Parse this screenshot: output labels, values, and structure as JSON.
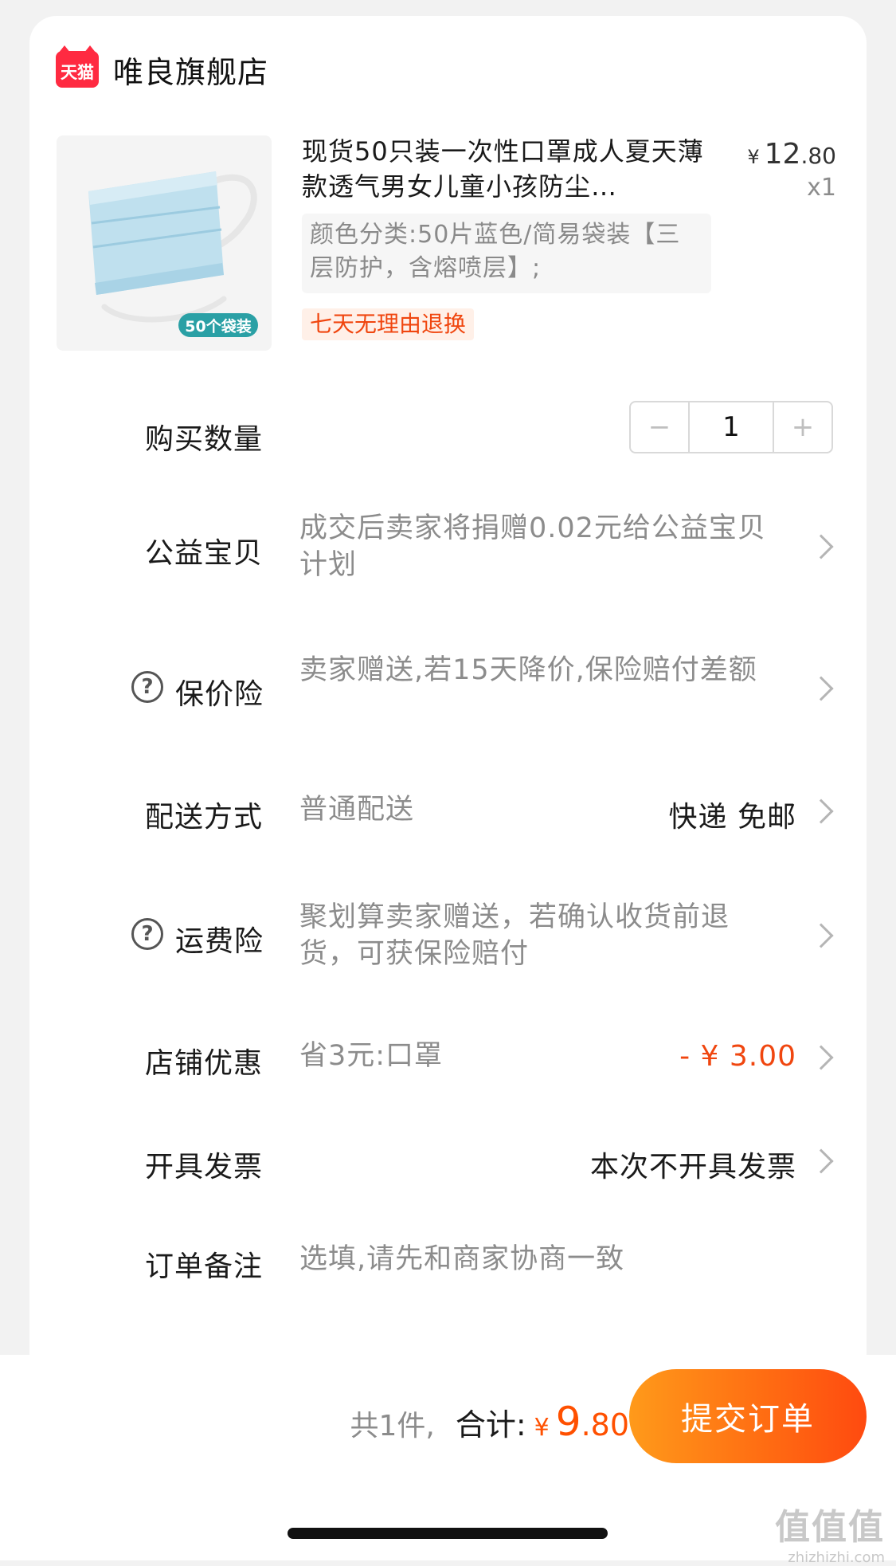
{
  "store": {
    "logo_text": "天猫",
    "name": "唯良旗舰店"
  },
  "product": {
    "badge": "50个袋装",
    "title": "现货50只装一次性口罩成人夏天薄款透气男女儿童小孩防尘…",
    "price_symbol": "¥",
    "price_int": "12",
    "price_dec": ".80",
    "quantity_text": "x1",
    "sku": "颜色分类:50片蓝色/简易袋装【三层防护，含熔喷层】;",
    "tag": "七天无理由退换"
  },
  "rows": {
    "quantity": {
      "label": "购买数量",
      "minus": "−",
      "value": "1",
      "plus": "+"
    },
    "charity": {
      "label": "公益宝贝",
      "value": "成交后卖家将捐赠0.02元给公益宝贝计划"
    },
    "price_protect": {
      "label": "保价险",
      "value": "卖家赠送,若15天降价,保险赔付差额"
    },
    "delivery": {
      "label": "配送方式",
      "value": "普通配送",
      "right": "快递 免邮"
    },
    "shipping_ins": {
      "label": "运费险",
      "value": "聚划算卖家赠送，若确认收货前退货，可获保险赔付"
    },
    "discount": {
      "label": "店铺优惠",
      "value": "省3元:口罩",
      "right": "- ¥ 3.00"
    },
    "invoice": {
      "label": "开具发票",
      "right": "本次不开具发票"
    },
    "remark": {
      "label": "订单备注",
      "placeholder": "选填,请先和商家协商一致"
    }
  },
  "footer": {
    "count_text": "共1件,",
    "total_label": "合计:",
    "price_symbol": "¥",
    "total_int": "9",
    "total_dec": ".80",
    "submit_label": "提交订单"
  },
  "watermark": {
    "line1": "值值值",
    "line2": "zhizhizhi.com"
  },
  "colors": {
    "accent": "#ff5000",
    "tmall_red": "#ff2a41",
    "tag_orange": "#f0460f"
  },
  "icons": {
    "help": "question-circle-icon",
    "chevron": "chevron-right-icon",
    "mask": "mask-product-image"
  }
}
